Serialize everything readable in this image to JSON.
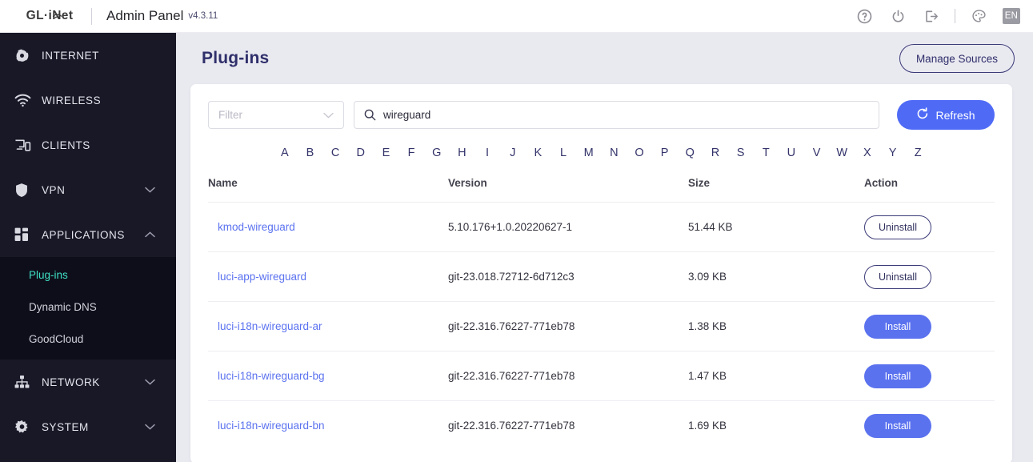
{
  "topbar": {
    "logo": "GL·iNet",
    "logo_icon": "wifi-signal-icon",
    "title": "Admin Panel",
    "version": "v4.3.11",
    "icons": [
      {
        "name": "help-icon",
        "glyph": "?"
      },
      {
        "name": "power-icon",
        "glyph": "power"
      },
      {
        "name": "logout-icon",
        "glyph": "logout"
      },
      {
        "name": "theme-palette-icon",
        "glyph": "palette"
      }
    ],
    "language": "EN"
  },
  "sidebar": {
    "items": [
      {
        "label": "INTERNET",
        "icon": "globe-icon",
        "expandable": false
      },
      {
        "label": "WIRELESS",
        "icon": "wifi-icon",
        "expandable": false
      },
      {
        "label": "CLIENTS",
        "icon": "devices-icon",
        "expandable": false
      },
      {
        "label": "VPN",
        "icon": "shield-icon",
        "expandable": true,
        "expanded": false
      },
      {
        "label": "APPLICATIONS",
        "icon": "grid-icon",
        "expandable": true,
        "expanded": true
      },
      {
        "label": "NETWORK",
        "icon": "network-tree-icon",
        "expandable": true,
        "expanded": false
      },
      {
        "label": "SYSTEM",
        "icon": "gear-icon",
        "expandable": true,
        "expanded": false
      }
    ],
    "submenu": [
      {
        "label": "Plug-ins",
        "active": true
      },
      {
        "label": "Dynamic DNS",
        "active": false
      },
      {
        "label": "GoodCloud",
        "active": false
      }
    ],
    "active_color": "#3ee0c4"
  },
  "page": {
    "title": "Plug-ins",
    "manage_sources_label": "Manage Sources"
  },
  "toolbar": {
    "filter_placeholder": "Filter",
    "search_value": "wireguard",
    "search_icon": "search-icon",
    "refresh_label": "Refresh",
    "refresh_icon": "refresh-icon",
    "refresh_color": "#4f6bf6"
  },
  "alphabet": [
    "A",
    "B",
    "C",
    "D",
    "E",
    "F",
    "G",
    "H",
    "I",
    "J",
    "K",
    "L",
    "M",
    "N",
    "O",
    "P",
    "Q",
    "R",
    "S",
    "T",
    "U",
    "V",
    "W",
    "X",
    "Y",
    "Z"
  ],
  "table": {
    "columns": [
      "Name",
      "Version",
      "Size",
      "Action"
    ],
    "rows": [
      {
        "name": "kmod-wireguard",
        "version": "5.10.176+1.0.20220627-1",
        "size": "51.44 KB",
        "action": "Uninstall",
        "installed": true
      },
      {
        "name": "luci-app-wireguard",
        "version": "git-23.018.72712-6d712c3",
        "size": "3.09 KB",
        "action": "Uninstall",
        "installed": true
      },
      {
        "name": "luci-i18n-wireguard-ar",
        "version": "git-22.316.76227-771eb78",
        "size": "1.38 KB",
        "action": "Install",
        "installed": false
      },
      {
        "name": "luci-i18n-wireguard-bg",
        "version": "git-22.316.76227-771eb78",
        "size": "1.47 KB",
        "action": "Install",
        "installed": false
      },
      {
        "name": "luci-i18n-wireguard-bn",
        "version": "git-22.316.76227-771eb78",
        "size": "1.69 KB",
        "action": "Install",
        "installed": false
      }
    ]
  }
}
